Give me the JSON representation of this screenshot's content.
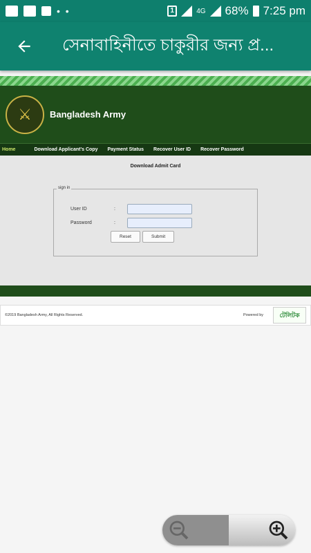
{
  "status_bar": {
    "battery": "68%",
    "time": "7:25 pm",
    "sim": "1",
    "network": "4G"
  },
  "app_bar": {
    "title": "সেনাবাহিনীতে চাকুরীর জন্য প্র..."
  },
  "site": {
    "brand": "Bangladesh Army",
    "nav": [
      "Home",
      "Download Applicant's Copy",
      "Payment Status",
      "Recover User ID",
      "Recover Password"
    ],
    "page_heading": "Download Admit Card",
    "signin": {
      "legend": "sign in",
      "userid_label": "User ID",
      "password_label": "Password",
      "colon": ":",
      "userid_value": "",
      "password_value": "",
      "reset_label": "Reset",
      "submit_label": "Submit"
    },
    "footer": {
      "copyright": "©2019 Bangladesh Army, All Rights Reserved.",
      "powered_by": "Powered by",
      "partner_logo_text": "টেলিটক"
    }
  },
  "zoom": {
    "out_icon": "zoom-out-icon",
    "in_icon": "zoom-in-icon"
  },
  "colors": {
    "app_bar": "#0f826f",
    "header": "#1f4d1a"
  }
}
